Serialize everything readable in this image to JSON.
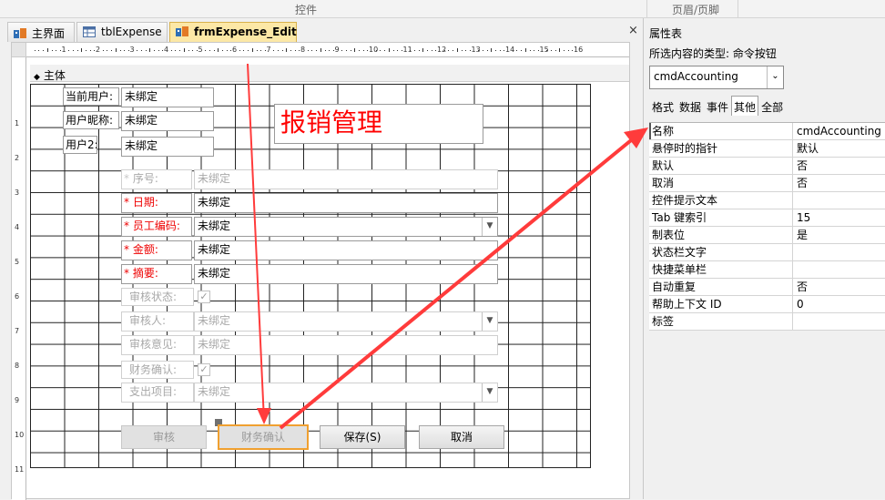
{
  "ribbon": {
    "controls_label": "控件",
    "header_footer_label": "页眉/页脚"
  },
  "tabs": [
    {
      "label": "主界面",
      "icon": "form-icon"
    },
    {
      "label": "tblExpense",
      "icon": "table-icon"
    },
    {
      "label": "frmExpense_Edit",
      "icon": "form-icon"
    }
  ],
  "doc_close": "×",
  "ruler": {
    "h_numbers": [
      "1",
      "2",
      "3",
      "4",
      "5",
      "6",
      "7",
      "8",
      "9",
      "10",
      "11",
      "12",
      "13",
      "14",
      "15",
      "16"
    ],
    "v_numbers": [
      "1",
      "2",
      "3",
      "4",
      "5",
      "6",
      "7",
      "8",
      "9",
      "10",
      "11"
    ]
  },
  "section": {
    "label": "主体"
  },
  "form": {
    "user_fields": [
      {
        "label": "当前用户:",
        "value": "未绑定"
      },
      {
        "label": "用户昵称:",
        "value": "未绑定"
      },
      {
        "label": "用户2:",
        "value": "未绑定"
      }
    ],
    "title": "报销管理",
    "fields": [
      {
        "label": "序号:",
        "value": "未绑定",
        "required": true,
        "disabled": true
      },
      {
        "label": "日期:",
        "value": "未绑定",
        "required": true
      },
      {
        "label": "员工编码:",
        "value": "未绑定",
        "required": true,
        "combo": true
      },
      {
        "label": "金额:",
        "value": "未绑定",
        "required": true
      },
      {
        "label": "摘要:",
        "value": "未绑定",
        "required": true
      }
    ],
    "audit_status_label": "审核状态:",
    "auditor_label": "审核人:",
    "auditor_value": "未绑定",
    "audit_opinion_label": "审核意见:",
    "audit_opinion_value": "未绑定",
    "finance_confirm_label": "财务确认:",
    "expense_item_label": "支出项目:",
    "expense_item_value": "未绑定",
    "buttons": {
      "audit": "审核",
      "finance_confirm": "财务确认",
      "save": "保存(S)",
      "cancel": "取消"
    }
  },
  "props": {
    "title": "属性表",
    "selection_type": "所选内容的类型: 命令按钮",
    "selected_control": "cmdAccounting",
    "tabs": [
      "格式",
      "数据",
      "事件",
      "其他",
      "全部"
    ],
    "active_tab": "其他",
    "rows": [
      {
        "name": "名称",
        "value": "cmdAccounting"
      },
      {
        "name": "悬停时的指针",
        "value": "默认"
      },
      {
        "name": "默认",
        "value": "否"
      },
      {
        "name": "取消",
        "value": "否"
      },
      {
        "name": "控件提示文本",
        "value": ""
      },
      {
        "name": "Tab 键索引",
        "value": "15"
      },
      {
        "name": "制表位",
        "value": "是"
      },
      {
        "name": "状态栏文字",
        "value": ""
      },
      {
        "name": "快捷菜单栏",
        "value": ""
      },
      {
        "name": "自动重复",
        "value": "否"
      },
      {
        "name": "帮助上下文 ID",
        "value": "0"
      },
      {
        "name": "标签",
        "value": ""
      }
    ]
  },
  "colors": {
    "arrow": "#ff3b3b",
    "title_red": "#ff0000",
    "active_tab": "#fce8a6",
    "selected_outline": "#f0a030"
  }
}
